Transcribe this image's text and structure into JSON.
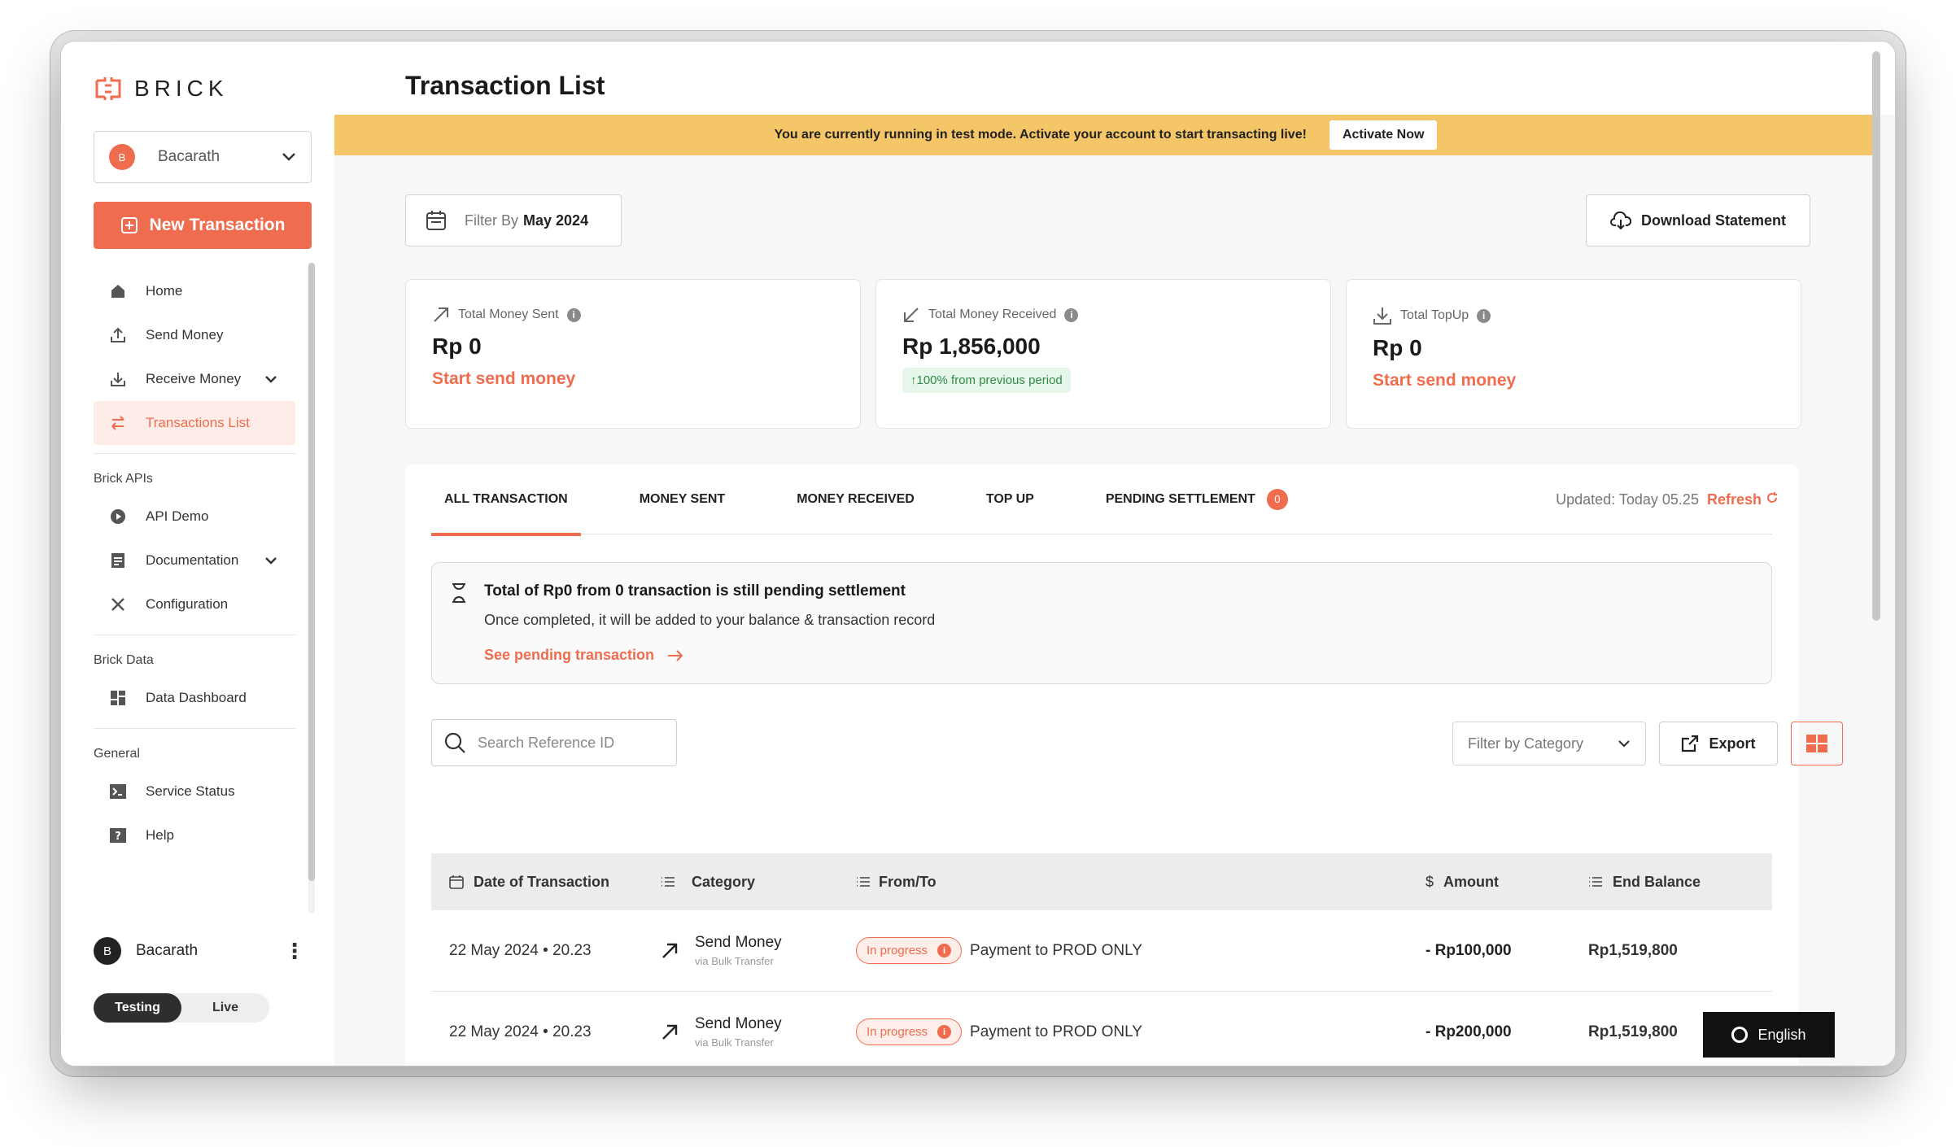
{
  "brand": {
    "name": "BRICK",
    "accent": "#ef6c4f"
  },
  "account": {
    "initial": "B",
    "name": "Bacarath"
  },
  "sidebar": {
    "new_transaction": "New Transaction",
    "items": [
      {
        "label": "Home",
        "icon": "home-icon"
      },
      {
        "label": "Send Money",
        "icon": "upload-icon"
      },
      {
        "label": "Receive Money",
        "icon": "download-icon"
      },
      {
        "label": "Transactions List",
        "icon": "swap-icon"
      }
    ],
    "sections": [
      {
        "title": "Brick APIs",
        "items": [
          {
            "label": "API Demo"
          },
          {
            "label": "Documentation"
          },
          {
            "label": "Configuration"
          }
        ]
      },
      {
        "title": "Brick Data",
        "items": [
          {
            "label": "Data Dashboard"
          }
        ]
      },
      {
        "title": "General",
        "items": [
          {
            "label": "Service Status"
          },
          {
            "label": "Help"
          }
        ]
      }
    ],
    "user": {
      "initial": "B",
      "name": "Bacarath"
    },
    "mode": {
      "testing": "Testing",
      "live": "Live",
      "active": "Testing"
    }
  },
  "page": {
    "title": "Transaction List"
  },
  "banner": {
    "text": "You are currently running in test mode. Activate your account to start transacting live!",
    "button": "Activate Now",
    "color": "#f5c668"
  },
  "filter": {
    "prefix": "Filter By",
    "value": "May 2024"
  },
  "download_label": "Download Statement",
  "cards": [
    {
      "label": "Total Money Sent",
      "value": "Rp 0",
      "link": "Start send money"
    },
    {
      "label": "Total Money Received",
      "value": "Rp 1,856,000",
      "pill": "↑100% from previous period"
    },
    {
      "label": "Total TopUp",
      "value": "Rp 0",
      "link": "Start send money"
    }
  ],
  "tabs": [
    {
      "label": "ALL TRANSACTION"
    },
    {
      "label": "MONEY SENT"
    },
    {
      "label": "MONEY RECEIVED"
    },
    {
      "label": "TOP UP"
    },
    {
      "label": "PENDING SETTLEMENT",
      "badge": "0"
    }
  ],
  "updated": {
    "text": "Updated: Today 05.25",
    "refresh": "Refresh"
  },
  "pending": {
    "title": "Total of Rp0 from 0 transaction is still pending settlement",
    "subtitle": "Once completed, it will be added to your balance & transaction record",
    "link": "See pending transaction"
  },
  "search": {
    "placeholder": "Search Reference ID"
  },
  "category_filter": "Filter by Category",
  "export_label": "Export",
  "table": {
    "headers": [
      "Date of Transaction",
      "Category",
      "From/To",
      "Amount",
      "End Balance"
    ],
    "rows": [
      {
        "date": "22 May 2024 • 20.23",
        "category": "Send Money",
        "via": "via Bulk Transfer",
        "status": "In progress",
        "party": "Payment to PROD ONLY",
        "amount": "- Rp100,000",
        "end_balance": "Rp1,519,800"
      },
      {
        "date": "22 May 2024 • 20.23",
        "category": "Send Money",
        "via": "via Bulk Transfer",
        "status": "In progress",
        "party": "Payment to PROD ONLY",
        "amount": "- Rp200,000",
        "end_balance": "Rp1,519,800"
      }
    ]
  },
  "language": "English"
}
